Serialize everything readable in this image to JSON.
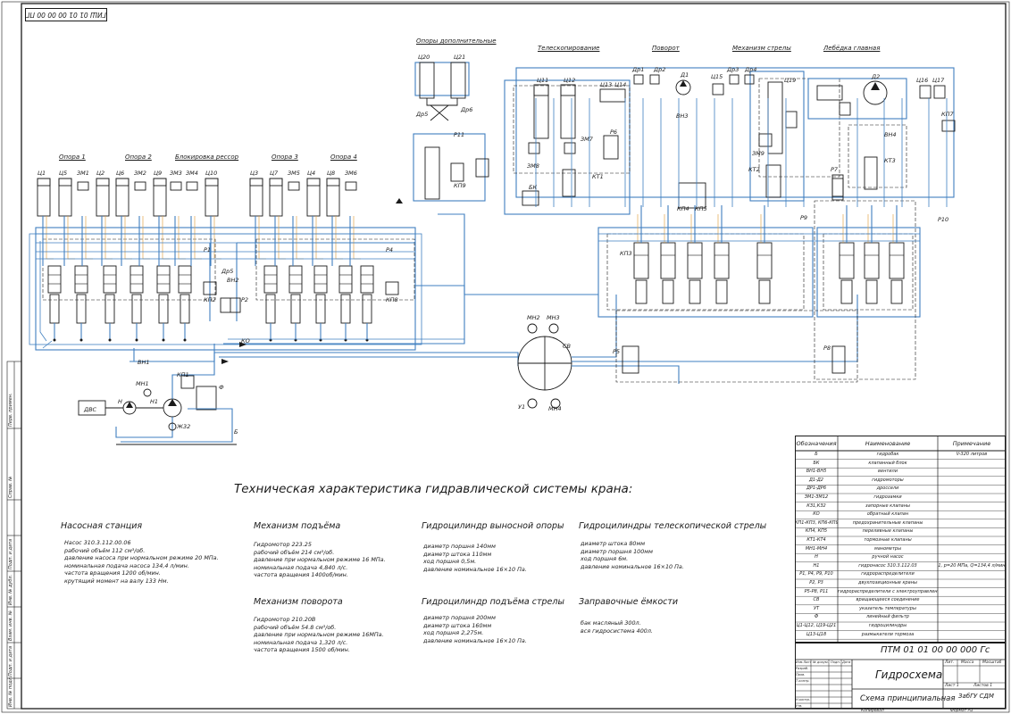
{
  "drawing": {
    "stamp_top_right": "",
    "stamp_top_left": "ГИШ 01 01 00 00 00 ПГ",
    "sections_top": [
      "Опоры дополнительные",
      "Телескопирование",
      "Поворот",
      "Механизм стрелы",
      "Лебёдка главная"
    ],
    "sections_outriggers": [
      "Опора 1",
      "Опора 2",
      "Блокировка рессор",
      "Опора 3",
      "Опора 4"
    ],
    "labels_cyl_left": [
      "Ц1",
      "Ц5",
      "ЗМ1",
      "Ц2",
      "Ц6",
      "ЗМ2",
      "Ц9",
      "ЗМ3",
      "ЗМ4",
      "Ц10"
    ],
    "labels_cyl_right": [
      "Ц3",
      "Ц7",
      "ЗМ5",
      "Ц4",
      "Ц8",
      "ЗМ6"
    ],
    "labels_misc": [
      "Ц20",
      "Ц21",
      "Др5",
      "Др6",
      "Р11",
      "КП9",
      "Ц11",
      "Ц12",
      "Ц13",
      "Ц14",
      "ЗМ7",
      "ЗМ8",
      "Р6",
      "КТ1",
      "БК",
      "Др1",
      "Др2",
      "Д1",
      "ВН3",
      "Ц15",
      "Др3",
      "Др4",
      "Ц19",
      "ЗМ9",
      "КТ2",
      "Д2",
      "Ц16",
      "Ц17",
      "КП7",
      "ВН4",
      "КТ3",
      "Р7",
      "КП4",
      "КП5",
      "Р9",
      "Р10",
      "КП3",
      "Р1",
      "Р4",
      "Др5",
      "ВН2",
      "Р2",
      "КП2",
      "КП8",
      "КО",
      "ВН1",
      "КП1",
      "МН1",
      "Н",
      "Н1",
      "Ф",
      "Ж32",
      "Б",
      "ДВС",
      "МН2",
      "МН3",
      "СВ",
      "У1",
      "МН4",
      "Р5",
      "Р8"
    ]
  },
  "tech": {
    "title": "Техническая характеристика гидравлической системы крана:",
    "sections": [
      {
        "title": "Насосная станция",
        "lines": [
          "Насос 310.3.112.00.06",
          "рабочий объём      112 см³/об.",
          "давление насоса при нормальном режиме  20 МПа.",
          "номинальная подача насоса   134,4 л/мин.",
          "частота вращения       1200 об/мин.",
          "крутящий момент на валу   133 Нм."
        ]
      },
      {
        "title": "Механизм подъёма",
        "lines": [
          "Гидромотор 223.25",
          "рабочий объём       214 см³/об.",
          "давление при нормальном режиме  16 МПа.",
          "номинальная подача 4,840 л/с.",
          "частота вращения      1400об/мин."
        ]
      },
      {
        "title": "Механизм поворота",
        "lines": [
          "Гидромотор 210.20В",
          "рабочий объём  54.8 см³/об.",
          "давление при нормальном режиме  16МПа.",
          "номинальная подача  1,320 л/с.",
          "частота вращения 1500 об/мин."
        ]
      },
      {
        "title": "Гидроцилиндр выносной опоры",
        "lines": [
          "диаметр поршня    140мм",
          "диаметр штока     110мм",
          "ход поршня         0,5м.",
          "давление номинальное  16×10 Па."
        ]
      },
      {
        "title": "Гидроцилиндр подъёма стрелы",
        "lines": [
          "диаметр поршня    200мм",
          "диаметр штока     160мм",
          "ход поршня         2,275м.",
          "давление номинальное  16×10 Па."
        ]
      },
      {
        "title": "Гидроцилиндры телескопической стрелы",
        "lines": [
          "диаметр штока      80мм",
          "диаметр поршня    100мм",
          "ход поршня           6м.",
          "давление номинальное  16×10 Па."
        ]
      },
      {
        "title": "Заправочные ёмкости",
        "lines": [
          "бак масляный    300л.",
          "вся гидросистема   400л."
        ]
      }
    ]
  },
  "spec": {
    "headers": [
      "Обозначения",
      "Наименование",
      "Примечание"
    ],
    "rows": [
      [
        "Б",
        "гидробак",
        "V-320 литров"
      ],
      [
        "БК",
        "клапанный блок",
        ""
      ],
      [
        "ВН1-ВН5",
        "вентили",
        ""
      ],
      [
        "Д1-Д2",
        "гидромоторы",
        ""
      ],
      [
        "ДР1-ДР6",
        "дроссели",
        ""
      ],
      [
        "ЗМ1-ЗМ12",
        "гидрозамки",
        ""
      ],
      [
        "КЗ1,КЗ2",
        "запорные клапаны",
        ""
      ],
      [
        "КО",
        "обратный клапан",
        ""
      ],
      [
        "КП1-КП3, КП6-КП9",
        "предохранительные клапаны",
        ""
      ],
      [
        "КП4, КП5",
        "переливные клапаны",
        ""
      ],
      [
        "КТ1-КТ4",
        "тормозные клапаны",
        ""
      ],
      [
        "МН1-МН4",
        "манометры",
        ""
      ],
      [
        "Н",
        "ручной насос",
        ""
      ],
      [
        "Н1",
        "гидронасос 310.3.112.03",
        "1, р=20 МПа, Q=134,4 л/мин"
      ],
      [
        "Р1, Р4, Р9, Р10",
        "гидрораспределители",
        ""
      ],
      [
        "Р2, Р3",
        "двухпозиционные краны",
        ""
      ],
      [
        "Р5-Р8, Р11",
        "гидрораспределители с электроуправлением",
        ""
      ],
      [
        "СВ",
        "вращающееся соединение",
        ""
      ],
      [
        "УТ",
        "указатель температуры",
        ""
      ],
      [
        "Ф",
        "линейный фильтр",
        ""
      ],
      [
        "Ц1-Ц12, Ц19-Ц21",
        "гидроцилиндры",
        ""
      ],
      [
        "Ц13-Ц18",
        "размыкатели тормоза",
        ""
      ]
    ]
  },
  "title_block": {
    "doc_code": "ПТМ 01 01 00 00 000 Гс",
    "title": "Гидросхема",
    "subtitle": "Схема принципиальная",
    "org": "ЗабГУ СДМ",
    "col_lit": "Лит.",
    "col_mass": "Масса",
    "col_scale": "Масштаб",
    "sheet": "Лист  1",
    "sheets": "Листов  1",
    "rows": [
      "Изм.Лист",
      "№ докум.",
      "Подп.",
      "Дата",
      "Разраб.",
      "Пров.",
      "Т.контр.",
      "Н.контр.",
      "Утв."
    ],
    "copied": "Копировал",
    "format": "Формат  А1"
  },
  "margin": [
    "Перв. примен.",
    "Справ. №",
    "Подп. и дата",
    "Инв. № дубл.",
    "Взам. инв. №",
    "Подп. и дата",
    "Инв. № подл."
  ]
}
